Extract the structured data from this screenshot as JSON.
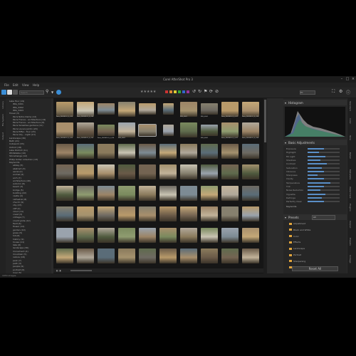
{
  "app": {
    "title": "Corel AfterShot Pro 3"
  },
  "menu": [
    "File",
    "Edit",
    "View",
    "Help"
  ],
  "toolbar": {
    "search_placeholder": "Search",
    "stars": "★★★★★",
    "zoom": "Fit"
  },
  "left_tabs": [
    "Library",
    "File System",
    "Output"
  ],
  "left_tree": [
    "Lake Tour (19)",
    "IMG_3201",
    "IMG_3202",
    "IMG_3203",
    "Travel (3)",
    "Paris Notre Dame (12)",
    "Paris France - architecture (14)",
    "Paris France - architecture (8)",
    "Paris Versailles gardens (11)",
    "Paris Louvre Jardin (20)",
    "Paris Eiffel - Tour (15)",
    "Paris City - night (13)",
    "Landscape (30)",
    "Bath (21)",
    "Cotswold (33)",
    "Oxford (18)",
    "Lake District (11)",
    "Whitstable (10)",
    "Stonehenge (12)",
    "Philip Kotler collection (13)",
    "Keywords",
    "abbey (5)",
    "abstract (3)",
    "aerial (2)",
    "animal (4)",
    "arch (7)",
    "architecture (40)",
    "autumn (6)",
    "beach (3)",
    "bridge (5)",
    "building (22)",
    "castle (4)",
    "cathedral (8)",
    "church (9)",
    "city (15)",
    "cliff (2)",
    "cloud (11)",
    "coast (3)",
    "cottage (7)",
    "countryside (12)",
    "field (6)",
    "flower (14)",
    "garden (10)",
    "grass (5)",
    "hill (8)",
    "history (9)",
    "house (11)",
    "lake (6)",
    "landscape (30)",
    "monument (4)",
    "mountain (5)",
    "nature (18)",
    "park (7)",
    "path (3)",
    "people (9)",
    "portrait (6)",
    "river (5)"
  ],
  "status_left": "1053 images",
  "right_panel": {
    "histogram_title": "Histogram",
    "basic_title": "Basic Adjustments",
    "adjust_labels": [
      "Exposure",
      "Highlight",
      "Fill Light",
      "Shadows",
      "Contrast",
      "Saturation",
      "Vibrance",
      "Sharpness",
      "Clarity",
      "Temperature",
      "Tint",
      "Noise Reduction",
      "Vignette",
      "Defringe",
      "Perfectly Clear"
    ],
    "adjust_values": [
      0.5,
      0.35,
      0.55,
      0.4,
      0.6,
      0.45,
      0.5,
      0.3,
      0.5,
      0.7,
      0.5,
      0.4,
      0.55,
      0.45,
      0.5
    ],
    "keywords_label": "Keywords",
    "presets_title": "Presets",
    "presets_select": "All",
    "presets": [
      "Adjustment",
      "Black and White",
      "Color",
      "Effects",
      "Landscape",
      "Portrait",
      "Sharpening",
      "Vintage"
    ],
    "reset_label": "Reset All"
  },
  "right_tabs": [
    "Standard",
    "Color",
    "Tone",
    "Detail",
    "Metadata",
    "Watermark",
    "Plugins",
    "Output",
    "Presets",
    "Vintage"
  ],
  "grid_captions": [
    "Paris_20090101_5_015",
    "Paris_20090101_5_016",
    "IMG_0001",
    "IMG_0002",
    "Paris_20090101_5_017",
    "Paris_20090101_5_018",
    "Paris_20090101_5_019"
  ],
  "colors": {
    "accent": "#5a8fc7",
    "folder": "#e0a43c",
    "app_bg": "#2b2b2b",
    "grid_bg": "#161616"
  }
}
